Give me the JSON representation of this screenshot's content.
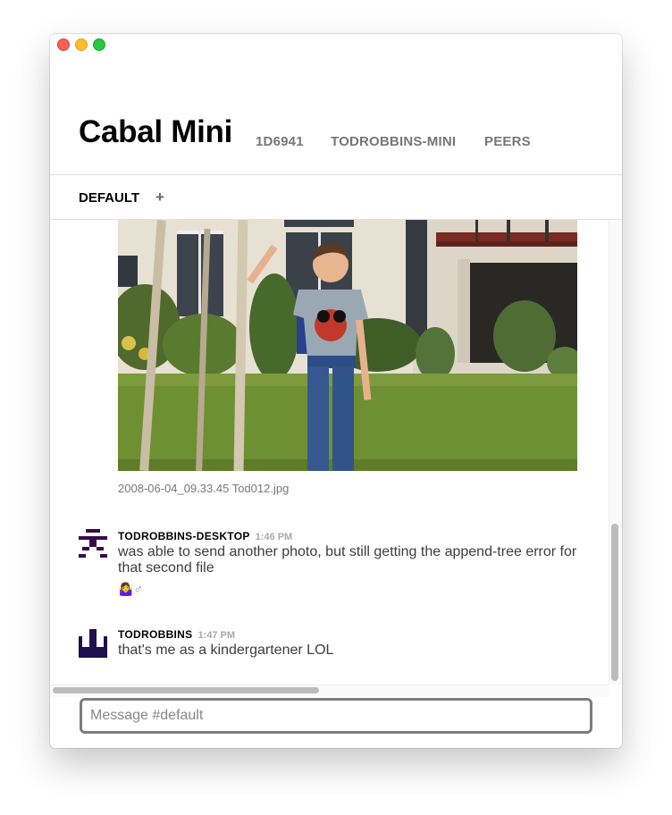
{
  "app": {
    "title": "Cabal Mini",
    "key_short": "1D6941",
    "username": "TODROBBINS-MINI",
    "peers_label": "PEERS"
  },
  "channels": {
    "active": "DEFAULT",
    "add_label": "+"
  },
  "photo": {
    "caption": "2008-06-04_09.33.45 Tod012.jpg"
  },
  "messages": [
    {
      "author": "TODROBBINS-DESKTOP",
      "time": "1:46 PM",
      "text": "was able to send another photo, but still getting the append-tree error for that second file",
      "reaction": "🤷‍♀️♂"
    },
    {
      "author": "TODROBBINS",
      "time": "1:47 PM",
      "text": "that's me as a kindergartener LOL"
    }
  ],
  "composer": {
    "placeholder": "Message #default",
    "value": ""
  },
  "colors": {
    "avatar_desktop": "#3a0a4a",
    "avatar_user": "#1e0f4d",
    "traffic_close": "#fe5f57",
    "traffic_min": "#febc2e",
    "traffic_max": "#28c840"
  }
}
